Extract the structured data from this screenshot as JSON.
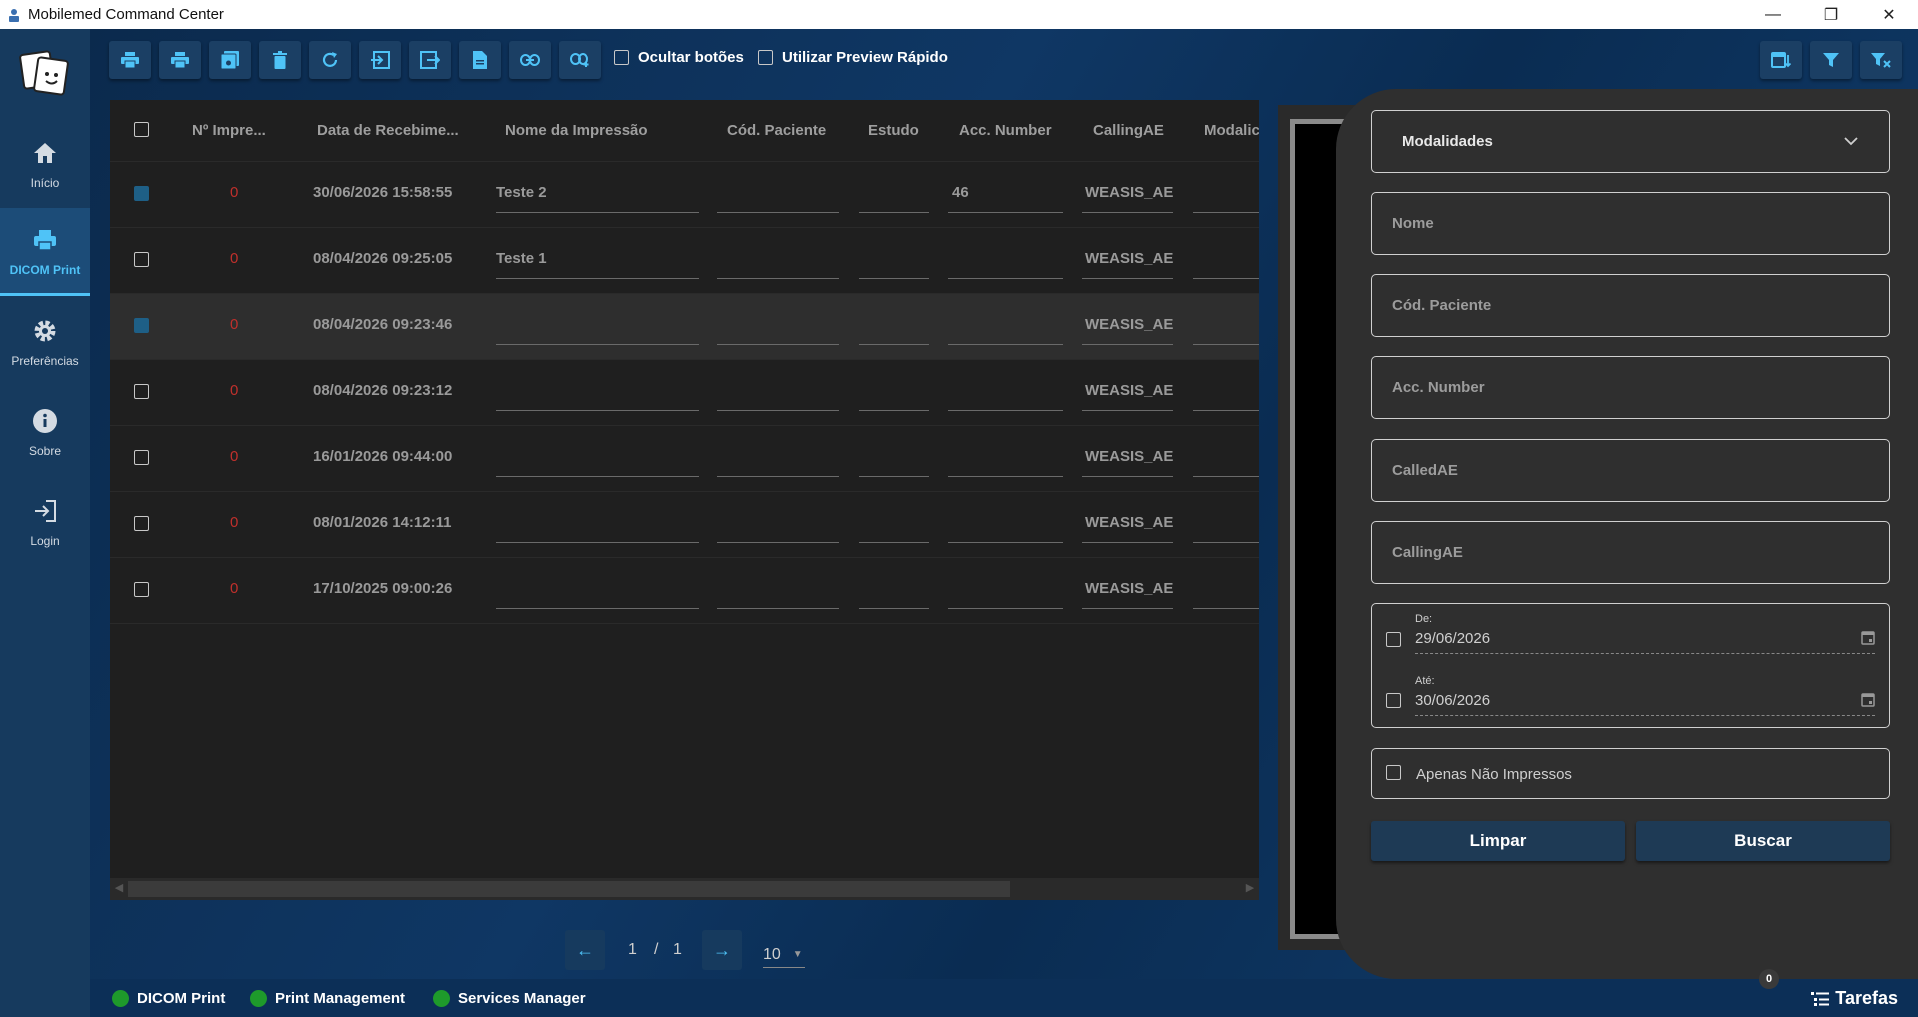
{
  "window": {
    "title": "Mobilemed Command Center"
  },
  "sidebar": {
    "items": [
      {
        "label": "Início",
        "icon": "home-icon"
      },
      {
        "label": "DICOM Print",
        "icon": "printer-icon",
        "active": true
      },
      {
        "label": "Preferências",
        "icon": "gear-icon"
      },
      {
        "label": "Sobre",
        "icon": "info-icon"
      },
      {
        "label": "Login",
        "icon": "login-icon"
      }
    ]
  },
  "toolbar": {
    "buttons": [
      "print-icon",
      "print-alt-icon",
      "save-icon",
      "delete-icon",
      "refresh-icon",
      "import-icon",
      "export-icon",
      "document-icon",
      "link-icon",
      "link-add-icon"
    ],
    "hide_buttons_label": "Ocultar botões",
    "quick_preview_label": "Utilizar Preview Rápido",
    "right_buttons": [
      "date-sort-icon",
      "filter-icon",
      "filter-clear-icon"
    ]
  },
  "table": {
    "columns": [
      "Nº Impre...",
      "Data de Recebime...",
      "Nome da Impressão",
      "Cód. Paciente",
      "Estudo",
      "Acc. Number",
      "CallingAE",
      "Modalic"
    ],
    "rows": [
      {
        "checked": true,
        "count": "0",
        "date": "30/06/2026 15:58:55",
        "name": "Teste 2",
        "patient": "",
        "study": "",
        "acc": "46",
        "calling": "WEASIS_AE"
      },
      {
        "checked": false,
        "count": "0",
        "date": "08/04/2026 09:25:05",
        "name": "Teste 1",
        "patient": "",
        "study": "",
        "acc": "",
        "calling": "WEASIS_AE"
      },
      {
        "checked": true,
        "count": "0",
        "date": "08/04/2026 09:23:46",
        "name": "",
        "patient": "",
        "study": "",
        "acc": "",
        "calling": "WEASIS_AE",
        "selected": true
      },
      {
        "checked": false,
        "count": "0",
        "date": "08/04/2026 09:23:12",
        "name": "",
        "patient": "",
        "study": "",
        "acc": "",
        "calling": "WEASIS_AE"
      },
      {
        "checked": false,
        "count": "0",
        "date": "16/01/2026 09:44:00",
        "name": "",
        "patient": "",
        "study": "",
        "acc": "",
        "calling": "WEASIS_AE"
      },
      {
        "checked": false,
        "count": "0",
        "date": "08/01/2026 14:12:11",
        "name": "",
        "patient": "",
        "study": "",
        "acc": "",
        "calling": "WEASIS_AE"
      },
      {
        "checked": false,
        "count": "0",
        "date": "17/10/2025 09:00:26",
        "name": "",
        "patient": "",
        "study": "",
        "acc": "",
        "calling": "WEASIS_AE"
      }
    ]
  },
  "pagination": {
    "current": "1",
    "separator": "/",
    "total": "1",
    "page_size": "10"
  },
  "filters": {
    "modalities_label": "Modalidades",
    "name_label": "Nome",
    "patient_label": "Cód. Paciente",
    "acc_label": "Acc. Number",
    "called_label": "CalledAE",
    "calling_label": "CallingAE",
    "from_label": "De:",
    "from_value": "29/06/2026",
    "to_label": "Até:",
    "to_value": "30/06/2026",
    "only_unprinted_label": "Apenas Não Impressos",
    "clear_label": "Limpar",
    "search_label": "Buscar"
  },
  "status": {
    "items": [
      "DICOM Print",
      "Print Management",
      "Services Manager"
    ],
    "status_color": "#1e9a2b",
    "tasks_label": "Tarefas",
    "tasks_count": "0"
  }
}
